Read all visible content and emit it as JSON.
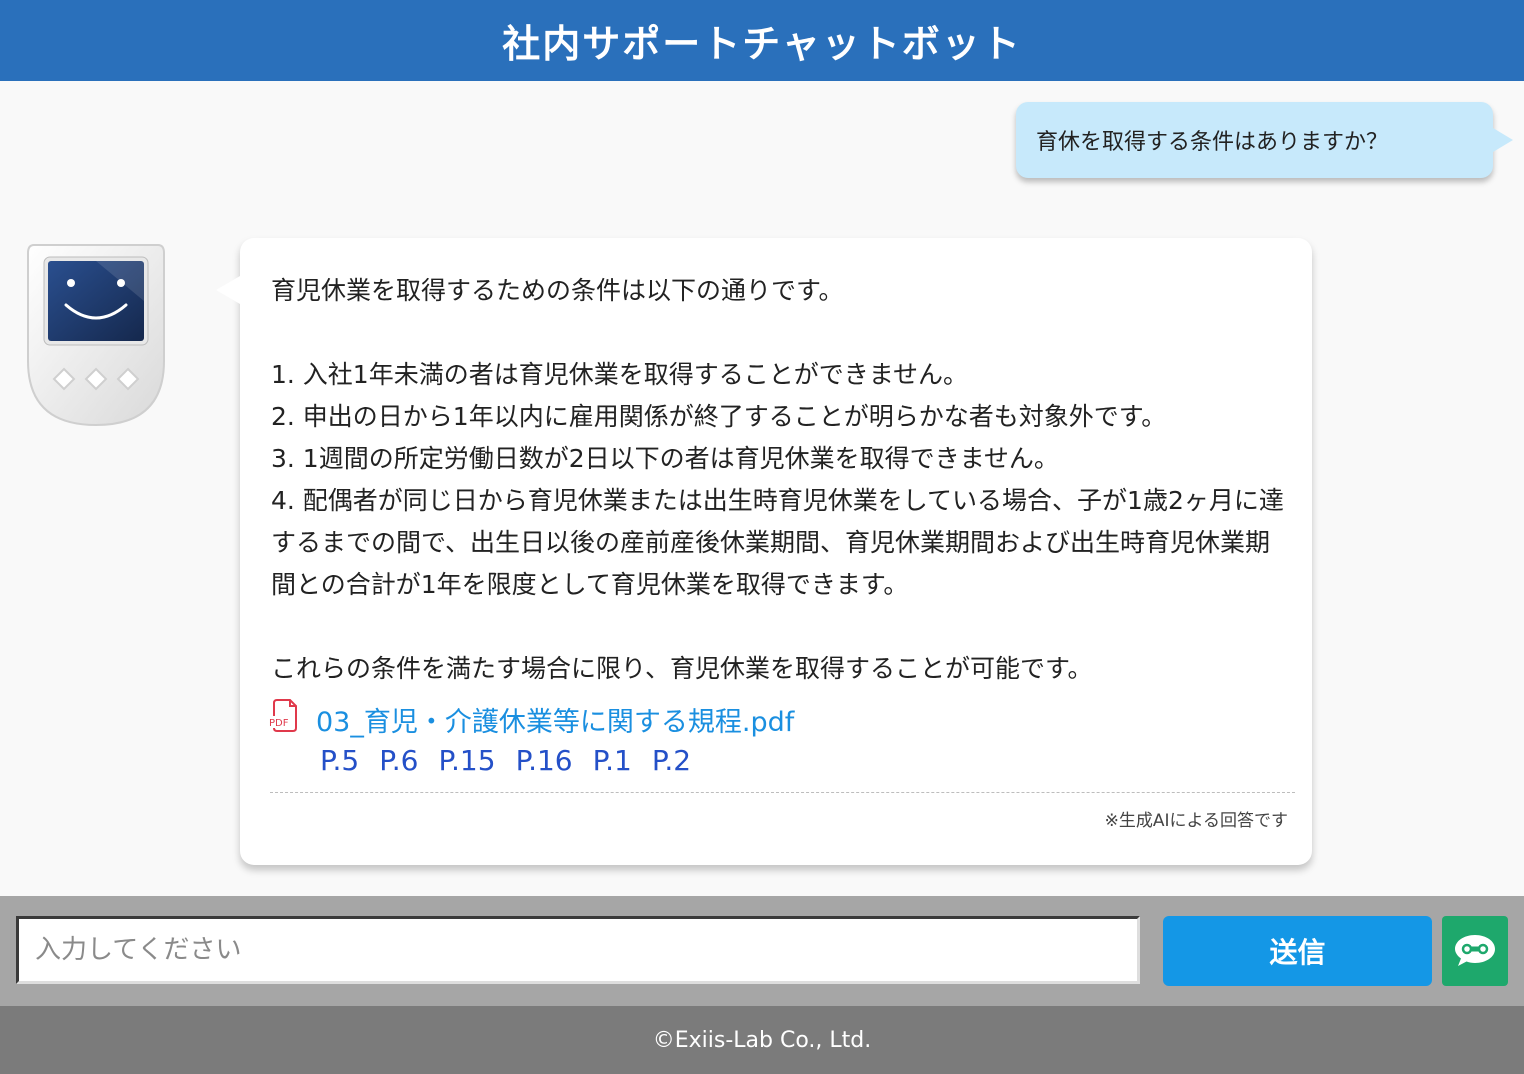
{
  "header": {
    "title": "社内サポートチャットボット"
  },
  "messages": {
    "user": {
      "text": "育休を取得する条件はありますか？"
    },
    "bot": {
      "intro": "育児休業を取得するための条件は以下の通りです。",
      "items": [
        "1. 入社1年未満の者は育児休業を取得することができません。",
        "2. 申出の日から1年以内に雇用関係が終了することが明らかな者も対象外です。",
        "3. 1週間の所定労働日数が2日以下の者は育児休業を取得できません。",
        "4. 配偶者が同じ日から育児休業または出生時育児休業をしている場合、子が1歳2ヶ月に達するまでの間で、出生日以後の産前産後休業期間、育児休業期間および出生時育児休業期間との合計が1年を限度として育児休業を取得できます。"
      ],
      "conclusion": "これらの条件を満たす場合に限り、育児休業を取得することが可能です。",
      "source": {
        "icon": "pdf-icon",
        "icon_label": "PDF",
        "file_name": "03_育児・介護休業等に関する規程.pdf",
        "pages": [
          "P.5",
          "P.6",
          "P.15",
          "P.16",
          "P.1",
          "P.2"
        ]
      },
      "note": "※生成AIによる回答です"
    }
  },
  "input": {
    "placeholder": "入力してください",
    "value": ""
  },
  "send_button": {
    "label": "送信"
  },
  "footer": {
    "copyright": "©Exiis-Lab Co., Ltd."
  },
  "colors": {
    "header": "#2a70bb",
    "user_bubble": "#c7e9fb",
    "send_button": "#1497e6",
    "toggle_button": "#1ea86c",
    "link": "#1a8fe0",
    "page_link": "#2450c8",
    "pdf_icon": "#e0394b"
  }
}
